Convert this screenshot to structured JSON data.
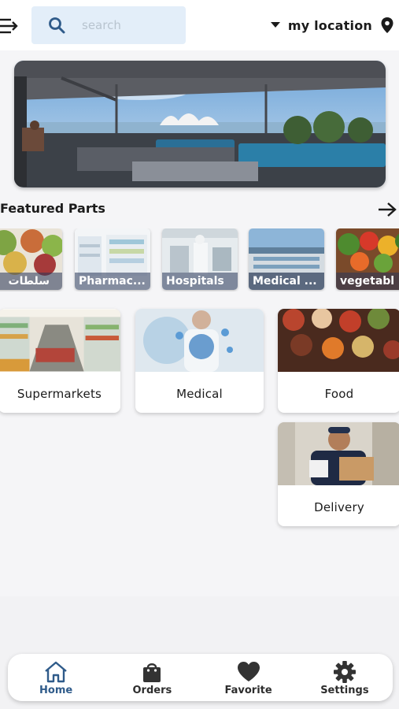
{
  "header": {
    "search_placeholder": "search",
    "location_label": "my location"
  },
  "featured": {
    "title": "Featured Parts",
    "items": [
      {
        "label": "سلطات",
        "icon": "salad-thumbnail"
      },
      {
        "label": "Pharmac...",
        "icon": "pharmacy-thumbnail"
      },
      {
        "label": "Hospitals",
        "icon": "hospital-thumbnail"
      },
      {
        "label": "Medical ...",
        "icon": "medical-center-thumbnail"
      },
      {
        "label": "vegetabl",
        "icon": "vegetables-thumbnail"
      }
    ]
  },
  "categories": [
    {
      "label": "Supermarkets"
    },
    {
      "label": "Medical"
    },
    {
      "label": "Food"
    },
    {
      "label": "Delivery"
    }
  ],
  "nav": {
    "items": [
      {
        "label": "Home",
        "icon": "home-icon",
        "active": true
      },
      {
        "label": "Orders",
        "icon": "shopping-bag-icon"
      },
      {
        "label": "Favorite",
        "icon": "heart-icon"
      },
      {
        "label": "Settings",
        "icon": "gear-icon"
      }
    ]
  },
  "colors": {
    "search_bg": "#e3eef9",
    "active_nav": "#2f5b8a",
    "background": "#f5f5f7"
  }
}
